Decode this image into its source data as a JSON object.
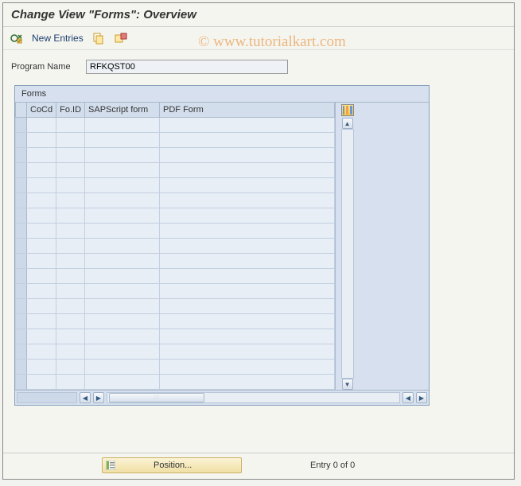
{
  "title": "Change View \"Forms\": Overview",
  "toolbar": {
    "new_entries_label": "New Entries"
  },
  "watermark": "© www.tutorialkart.com",
  "field": {
    "program_name_label": "Program Name",
    "program_name_value": "RFKQST00"
  },
  "panel": {
    "title": "Forms",
    "columns": {
      "cocd": "CoCd",
      "foid": "Fo.ID",
      "sapscript": "SAPScript form",
      "pdf": "PDF Form"
    },
    "rows": [
      {},
      {},
      {},
      {},
      {},
      {},
      {},
      {},
      {},
      {},
      {},
      {},
      {},
      {},
      {},
      {},
      {},
      {}
    ]
  },
  "footer": {
    "position_label": "Position...",
    "entry_status": "Entry 0 of 0"
  }
}
